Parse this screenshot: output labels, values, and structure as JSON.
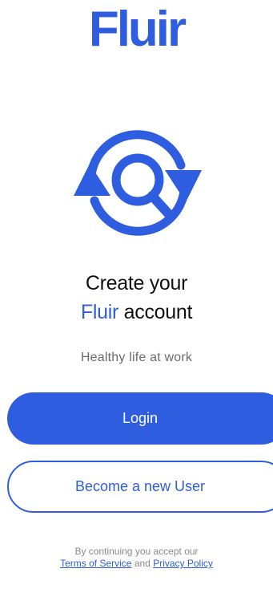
{
  "brand": {
    "logo_text": "Fluir",
    "accent_color": "#2f5de0"
  },
  "hero": {
    "icon": "refresh-search-icon"
  },
  "headline": {
    "line1": "Create your",
    "accent_word": "Fluir",
    "line2_rest": " account"
  },
  "subtitle": "Healthy life at work",
  "actions": {
    "login_label": "Login",
    "register_label": "Become a new User"
  },
  "legal": {
    "prefix": "By continuing you accept our",
    "terms_label": "Terms of Service",
    "conjunction": " and ",
    "privacy_label": "Privacy Policy"
  }
}
